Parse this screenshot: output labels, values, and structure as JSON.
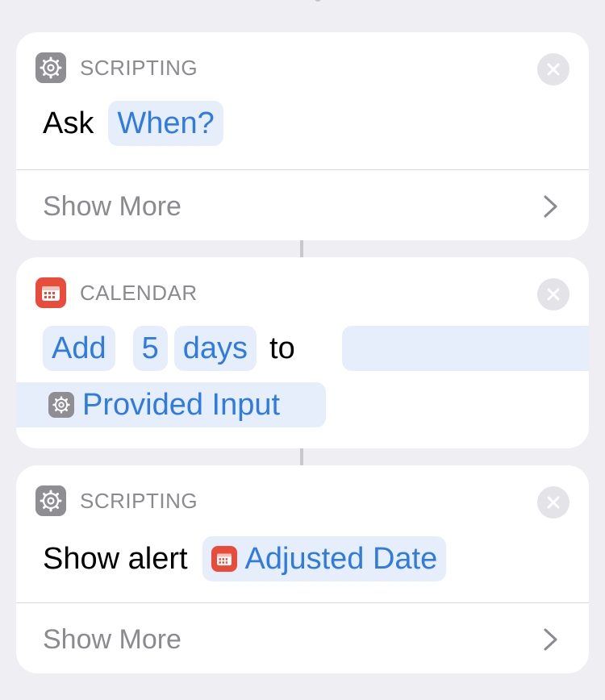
{
  "card1": {
    "category": "SCRIPTING",
    "icon": "gear-icon",
    "action_verb": "Ask",
    "prompt_token": "When?",
    "show_more": "Show More"
  },
  "card2": {
    "category": "CALENDAR",
    "icon": "calendar-icon",
    "operation_token": "Add",
    "amount_token": "5",
    "unit_token": "days",
    "connector_word": "to",
    "input_token": "Provided Input",
    "input_icon": "gear-icon"
  },
  "card3": {
    "category": "SCRIPTING",
    "icon": "gear-icon",
    "action_verb": "Show alert",
    "variable_token": "Adjusted Date",
    "variable_icon": "calendar-icon",
    "show_more": "Show More"
  },
  "colors": {
    "background": "#eeeef3",
    "token_text": "#2f7bdf",
    "token_bg": "#e6eefb",
    "scripting_icon": "#8e8e93",
    "calendar_icon": "#ea4c3c"
  }
}
